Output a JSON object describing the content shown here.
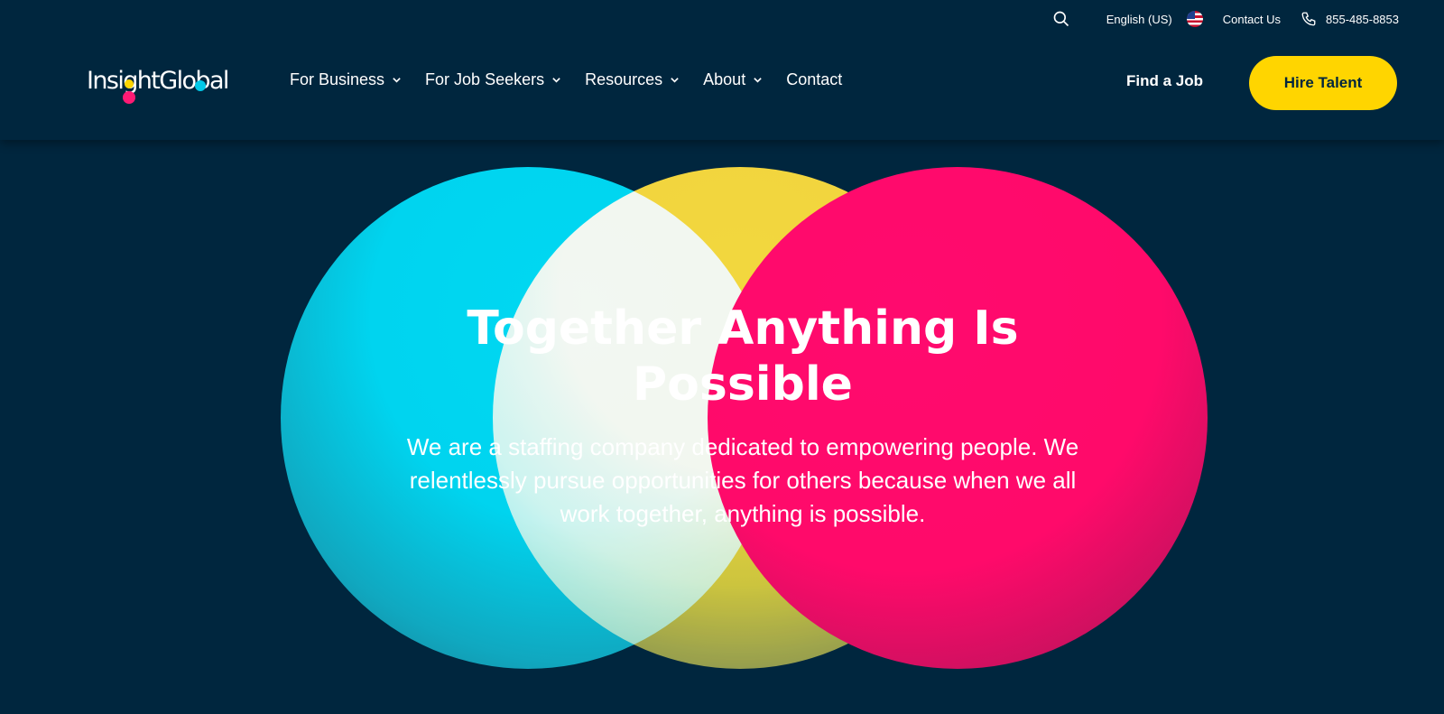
{
  "utility": {
    "language": "English (US)",
    "contact": "Contact Us",
    "phone": "855-485-8853"
  },
  "logo": {
    "text": "InsightGlobal"
  },
  "nav": {
    "items": [
      {
        "label": "For Business",
        "has_dropdown": true
      },
      {
        "label": "For Job Seekers",
        "has_dropdown": true
      },
      {
        "label": "Resources",
        "has_dropdown": true
      },
      {
        "label": "About",
        "has_dropdown": true
      },
      {
        "label": "Contact",
        "has_dropdown": false
      }
    ],
    "find_job": "Find a Job",
    "hire_talent": "Hire Talent"
  },
  "hero": {
    "title": "Together Anything Is Possible",
    "text": "We are a staffing company dedicated to empowering people. We relentlessly pursue opportunities for others because when we all work together, anything is possible."
  },
  "colors": {
    "background": "#00263e",
    "accent_yellow": "#ffd500",
    "cyan": "#00d8f2",
    "pink": "#ff0a6e"
  }
}
